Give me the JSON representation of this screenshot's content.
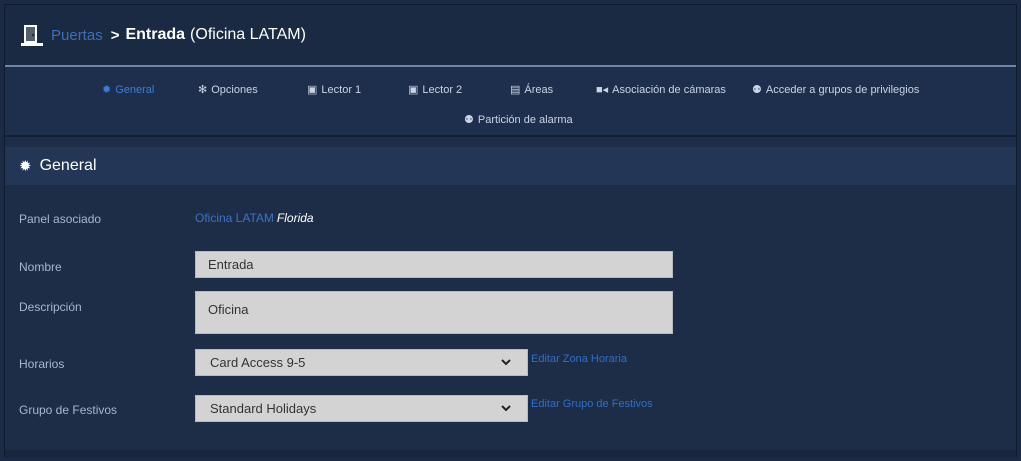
{
  "breadcrumb": {
    "parent": "Puertas",
    "separator": ">",
    "title": "Entrada",
    "subtitle": "(Oficina LATAM)"
  },
  "tabs": [
    {
      "label": "General",
      "icon": "gear-icon",
      "active": true
    },
    {
      "label": "Opciones",
      "icon": "gears-icon",
      "active": false
    },
    {
      "label": "Lector 1",
      "icon": "card-reader-icon",
      "active": false
    },
    {
      "label": "Lector 2",
      "icon": "card-reader-icon",
      "active": false
    },
    {
      "label": "Áreas",
      "icon": "building-icon",
      "active": false
    },
    {
      "label": "Asociación de cámaras",
      "icon": "video-camera-icon",
      "active": false
    },
    {
      "label": "Acceder a grupos de privilegios",
      "icon": "users-icon",
      "active": false
    },
    {
      "label": "Partición de alarma",
      "icon": "users-icon",
      "active": false
    }
  ],
  "section": {
    "title": "General",
    "icon": "gear-icon"
  },
  "form": {
    "panel": {
      "label": "Panel asociado",
      "link": "Oficina LATAM",
      "italic": "Florida"
    },
    "name": {
      "label": "Nombre",
      "value": "Entrada"
    },
    "description": {
      "label": "Descripción",
      "value": "Oficina"
    },
    "schedule": {
      "label": "Horarios",
      "value": "Card Access 9-5",
      "edit_link": "Editar Zona Horaria"
    },
    "holidays": {
      "label": "Grupo de Festivos",
      "value": "Standard Holidays",
      "edit_link": "Editar Grupo de Festivos"
    }
  },
  "colors": {
    "accent": "#3b7ed8",
    "background": "#1e2e4a",
    "input": "#d3d3d3"
  }
}
